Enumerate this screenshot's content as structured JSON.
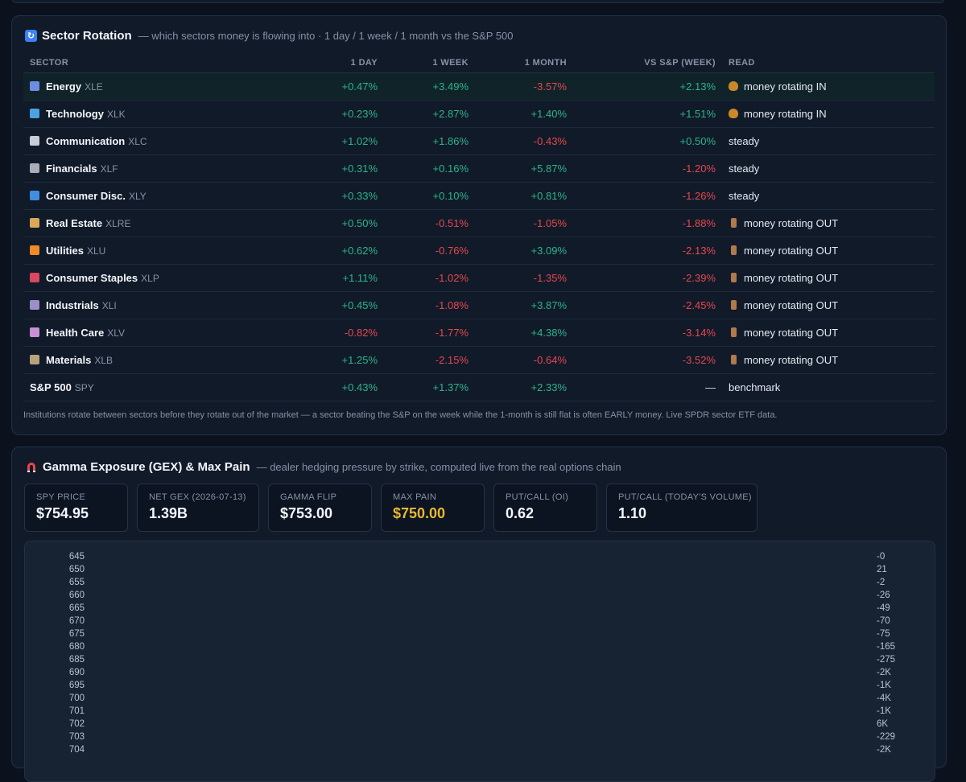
{
  "sector_panel": {
    "title": "Sector Rotation",
    "subtitle": "— which sectors money is flowing into · 1 day / 1 week / 1 month vs the S&P 500",
    "columns": [
      "SECTOR",
      "1 DAY",
      "1 WEEK",
      "1 MONTH",
      "VS S&P (WEEK)",
      "READ"
    ],
    "rows": [
      {
        "icon": "energy-icon",
        "icon_color": "#6b8de3",
        "name": "Energy",
        "ticker": "XLE",
        "d1": "+0.47%",
        "w1": "+3.49%",
        "m1": "-3.57%",
        "vs": "+2.13%",
        "read": "money rotating IN",
        "read_dir": "in"
      },
      {
        "icon": "laptop-icon",
        "icon_color": "#4aa3df",
        "name": "Technology",
        "ticker": "XLK",
        "d1": "+0.23%",
        "w1": "+2.87%",
        "m1": "+1.40%",
        "vs": "+1.51%",
        "read": "money rotating IN",
        "read_dir": "in"
      },
      {
        "icon": "satellite-icon",
        "icon_color": "#c7ccd6",
        "name": "Communication",
        "ticker": "XLC",
        "d1": "+1.02%",
        "w1": "+1.86%",
        "m1": "-0.43%",
        "vs": "+0.50%",
        "read": "steady",
        "read_dir": "none"
      },
      {
        "icon": "bank-icon",
        "icon_color": "#a9adb7",
        "name": "Financials",
        "ticker": "XLF",
        "d1": "+0.31%",
        "w1": "+0.16%",
        "m1": "+5.87%",
        "vs": "-1.20%",
        "read": "steady",
        "read_dir": "none"
      },
      {
        "icon": "shopping-bag-icon",
        "icon_color": "#3f8ee0",
        "name": "Consumer Disc.",
        "ticker": "XLY",
        "d1": "+0.33%",
        "w1": "+0.10%",
        "m1": "+0.81%",
        "vs": "-1.26%",
        "read": "steady",
        "read_dir": "none"
      },
      {
        "icon": "house-icon",
        "icon_color": "#d9a85a",
        "name": "Real Estate",
        "ticker": "XLRE",
        "d1": "+0.50%",
        "w1": "-0.51%",
        "m1": "-1.05%",
        "vs": "-1.88%",
        "read": "money rotating OUT",
        "read_dir": "out"
      },
      {
        "icon": "lightning-icon",
        "icon_color": "#f08a24",
        "name": "Utilities",
        "ticker": "XLU",
        "d1": "+0.62%",
        "w1": "-0.76%",
        "m1": "+3.09%",
        "vs": "-2.13%",
        "read": "money rotating OUT",
        "read_dir": "out"
      },
      {
        "icon": "can-icon",
        "icon_color": "#d9485f",
        "name": "Consumer Staples",
        "ticker": "XLP",
        "d1": "+1.11%",
        "w1": "-1.02%",
        "m1": "-1.35%",
        "vs": "-2.39%",
        "read": "money rotating OUT",
        "read_dir": "out"
      },
      {
        "icon": "factory-icon",
        "icon_color": "#9d8ec9",
        "name": "Industrials",
        "ticker": "XLI",
        "d1": "+0.45%",
        "w1": "-1.08%",
        "m1": "+3.87%",
        "vs": "-2.45%",
        "read": "money rotating OUT",
        "read_dir": "out"
      },
      {
        "icon": "hospital-icon",
        "icon_color": "#c98fd6",
        "name": "Health Care",
        "ticker": "XLV",
        "d1": "-0.82%",
        "w1": "-1.77%",
        "m1": "+4.38%",
        "vs": "-3.14%",
        "read": "money rotating OUT",
        "read_dir": "out"
      },
      {
        "icon": "pickaxe-icon",
        "icon_color": "#b8a27a",
        "name": "Materials",
        "ticker": "XLB",
        "d1": "+1.25%",
        "w1": "-2.15%",
        "m1": "-0.64%",
        "vs": "-3.52%",
        "read": "money rotating OUT",
        "read_dir": "out"
      }
    ],
    "benchmark": {
      "name": "S&P 500",
      "ticker": "SPY",
      "d1": "+0.43%",
      "w1": "+1.37%",
      "m1": "+2.33%",
      "vs": "—",
      "read": "benchmark"
    },
    "footnote": "Institutions rotate between sectors before they rotate out of the market — a sector beating the S&P on the week while the 1-month is still flat is often EARLY money. Live SPDR sector ETF data."
  },
  "gamma_panel": {
    "title": "Gamma Exposure (GEX) & Max Pain",
    "subtitle": "— dealer hedging pressure by strike, computed live from the real options chain",
    "stats": [
      {
        "label": "SPY PRICE",
        "value": "$754.95",
        "highlight": false
      },
      {
        "label": "NET GEX (2026-07-13)",
        "value": "1.39B",
        "highlight": false
      },
      {
        "label": "GAMMA FLIP",
        "value": "$753.00",
        "highlight": false
      },
      {
        "label": "MAX PAIN",
        "value": "$750.00",
        "highlight": true
      },
      {
        "label": "PUT/CALL (OI)",
        "value": "0.62",
        "highlight": false
      },
      {
        "label": "PUT/CALL (TODAY'S VOLUME)",
        "value": "1.10",
        "highlight": false
      }
    ],
    "strikes": [
      {
        "strike": "645",
        "gex": "-0"
      },
      {
        "strike": "650",
        "gex": "21"
      },
      {
        "strike": "655",
        "gex": "-2"
      },
      {
        "strike": "660",
        "gex": "-26"
      },
      {
        "strike": "665",
        "gex": "-49"
      },
      {
        "strike": "670",
        "gex": "-70"
      },
      {
        "strike": "675",
        "gex": "-75"
      },
      {
        "strike": "680",
        "gex": "-165"
      },
      {
        "strike": "685",
        "gex": "-275"
      },
      {
        "strike": "690",
        "gex": "-2K"
      },
      {
        "strike": "695",
        "gex": "-1K"
      },
      {
        "strike": "700",
        "gex": "-4K"
      },
      {
        "strike": "701",
        "gex": "-1K"
      },
      {
        "strike": "702",
        "gex": "6K"
      },
      {
        "strike": "703",
        "gex": "-229"
      },
      {
        "strike": "704",
        "gex": "-2K"
      }
    ]
  }
}
